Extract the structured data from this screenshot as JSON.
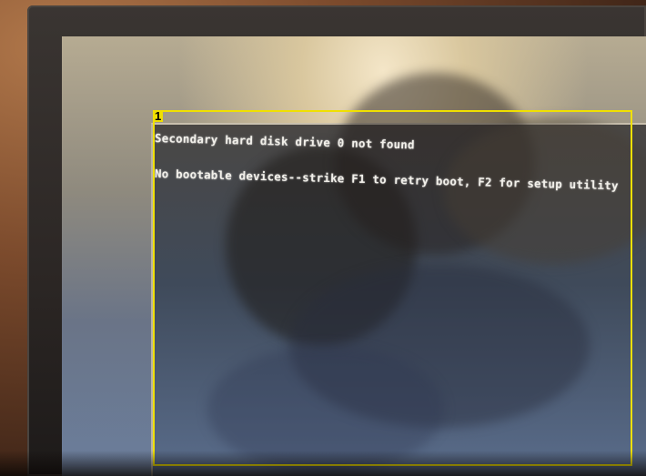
{
  "annotation": {
    "label": "1",
    "color": "#f0e000"
  },
  "screen": {
    "lines": [
      "Secondary hard disk drive 0 not found",
      "No bootable devices--strike F1 to retry boot, F2 for setup utility"
    ],
    "text_color": "#f2f0ea"
  }
}
